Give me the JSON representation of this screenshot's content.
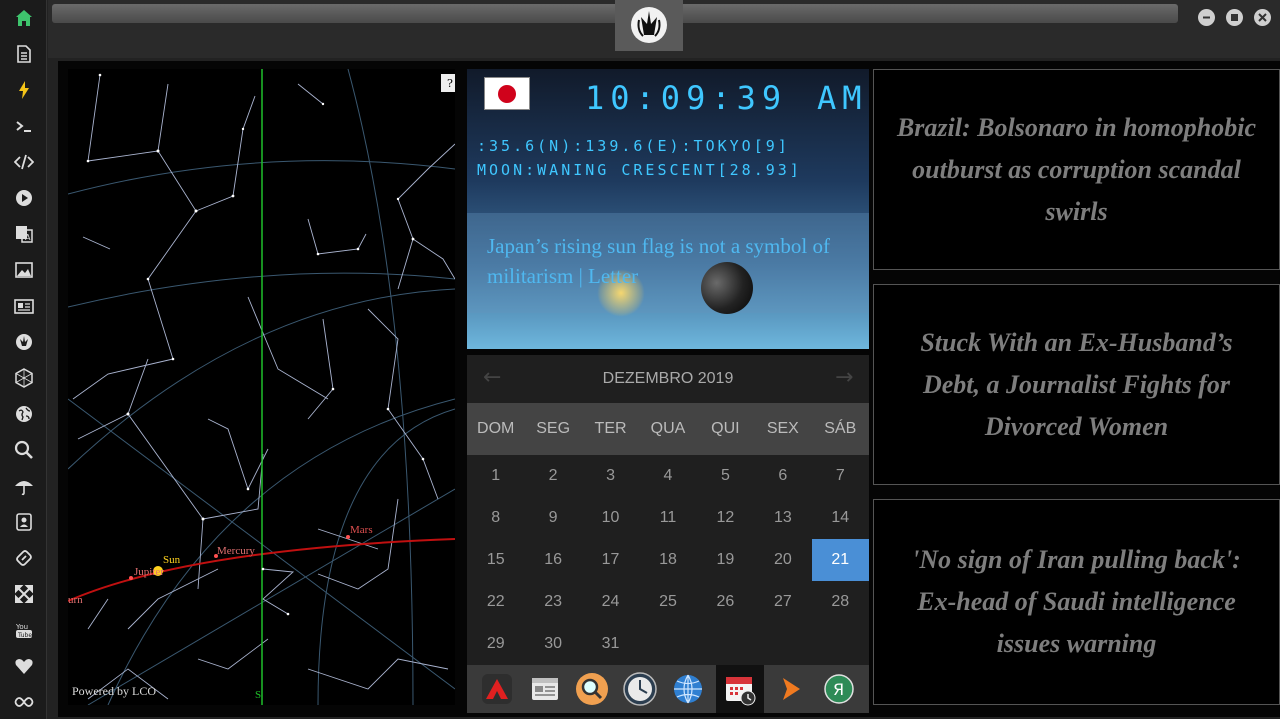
{
  "sidebar": {
    "items": [
      {
        "icon": "home-icon",
        "color": "#3ec46d"
      },
      {
        "icon": "document-icon"
      },
      {
        "icon": "lightning-icon",
        "color": "#f5c518"
      },
      {
        "icon": "terminal-icon"
      },
      {
        "icon": "code-icon"
      },
      {
        "icon": "play-icon"
      },
      {
        "icon": "translate-icon"
      },
      {
        "icon": "image-icon"
      },
      {
        "icon": "newspaper-icon"
      },
      {
        "icon": "rebel-alliance-icon"
      },
      {
        "icon": "hexagon-network-icon"
      },
      {
        "icon": "globe-icon"
      },
      {
        "icon": "search-icon"
      },
      {
        "icon": "umbrella-icon"
      },
      {
        "icon": "contacts-icon"
      },
      {
        "icon": "link-icon"
      },
      {
        "icon": "expand-icon"
      },
      {
        "icon": "youtube-icon",
        "label": "You Tube"
      },
      {
        "icon": "heart-icon"
      },
      {
        "icon": "infinity-icon"
      }
    ]
  },
  "skymap": {
    "help_label": "?",
    "powered_by": "Powered by LCO",
    "planet_labels": [
      "Mars",
      "Sun",
      "Mercury",
      "Jupiter",
      "urn"
    ],
    "compass_label": "S"
  },
  "clock": {
    "time": "10:09:39",
    "ampm": "AM",
    "location": ":35.6(N):139.6(E):TOKYO[9]",
    "moon": "MOON:WANING CRESCENT[28.93]",
    "headline": "Japan’s rising sun flag is not a symbol of militarism | Letter",
    "flag": "japan-flag-icon"
  },
  "calendar": {
    "title": "DEZEMBRO 2019",
    "weekdays": [
      "DOM",
      "SEG",
      "TER",
      "QUA",
      "QUI",
      "SEX",
      "SÁB"
    ],
    "days": [
      "1",
      "2",
      "3",
      "4",
      "5",
      "6",
      "7",
      "8",
      "9",
      "10",
      "11",
      "12",
      "13",
      "14",
      "15",
      "16",
      "17",
      "18",
      "19",
      "20",
      "21",
      "22",
      "23",
      "24",
      "25",
      "26",
      "27",
      "28",
      "29",
      "30",
      "31"
    ],
    "selected_day": "21",
    "selected_color": "#4a8fd6"
  },
  "dock": {
    "apps": [
      "arrow-up-app-icon",
      "news-app-icon",
      "search-app-icon",
      "clock-app-icon",
      "globe-app-icon",
      "calendar-app-icon",
      "play-arrow-app-icon",
      "yandex-app-icon"
    ],
    "active": "calendar-app-icon"
  },
  "news": [
    {
      "headline": "Brazil: Bolsonaro in homophobic outburst as corruption scandal swirls"
    },
    {
      "headline": "Stuck With an Ex-Husband’s Debt, a Journalist Fights for Divorced Women"
    },
    {
      "headline": "'No sign of Iran pulling back': Ex-head of Saudi intelligence issues warning"
    }
  ]
}
